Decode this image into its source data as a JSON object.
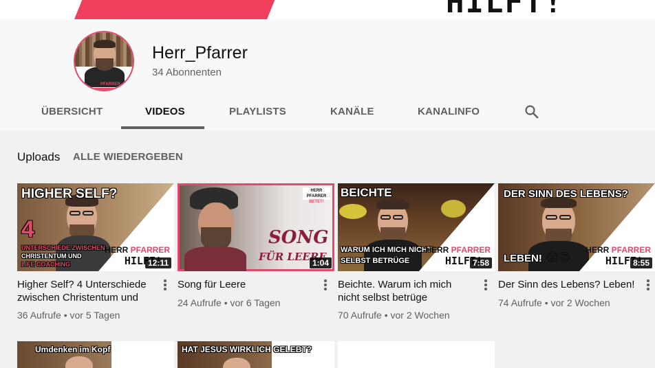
{
  "banner": {
    "text": "HILFT!"
  },
  "channel": {
    "name": "Herr_Pfarrer",
    "subscribers": "34 Abonnenten",
    "avatar_label_black": "HERR",
    "avatar_label_pink": "PFARRER"
  },
  "tabs": [
    {
      "label": "ÜBERSICHT"
    },
    {
      "label": "VIDEOS"
    },
    {
      "label": "PLAYLISTS"
    },
    {
      "label": "KANÄLE"
    },
    {
      "label": "KANALINFO"
    }
  ],
  "active_tab": "VIDEOS",
  "section": {
    "title": "Uploads",
    "play_all": "ALLE WIEDERGEBEN"
  },
  "videos": [
    {
      "title": "Higher Self? 4 Unterschiede zwischen Christentum und",
      "views": "36 Aufrufe",
      "age": "vor 5 Tagen",
      "duration": "12:11",
      "caption_top": "HIGHER SELF?",
      "caption_num": "4",
      "caption_lines": [
        "UNTERSCHIEDE ZWISCHEN",
        "CHRISTENTUM UND",
        "LIFE COACHING"
      ]
    },
    {
      "title": "Song für Leere",
      "views": "24 Aufrufe",
      "age": "vor 6 Tagen",
      "duration": "1:04",
      "caption_song": "SONG",
      "caption_fuer": "FÜR LEERE",
      "badge_black": "HERR PFARRER",
      "badge_pink": "BETET!"
    },
    {
      "title": "Beichte. Warum ich mich nicht selbst betrüge",
      "views": "70 Aufrufe",
      "age": "vor 2 Wochen",
      "duration": "7:58",
      "caption_top": "BEICHTE",
      "caption_lines": [
        "WARUM ICH MICH NICHT",
        "SELBST BETRÜGE"
      ]
    },
    {
      "title": "Der Sinn des Lebens? Leben!",
      "views": "74 Aufrufe",
      "age": "vor 2 Wochen",
      "duration": "8:55",
      "caption_top": "DER SINN DES LEBENS?",
      "caption_bottom": "LEBEN!",
      "emojis": "😱😍"
    }
  ],
  "brand": {
    "herr": "HERR",
    "pfarrer": "PFARRER",
    "hilft": "HILFT!"
  },
  "row2": [
    {
      "caption": "Umdenken im Kopf"
    },
    {
      "caption": "HAT JESUS WIRKLICH GELEBT?"
    },
    {
      "caption": ""
    }
  ],
  "colors": {
    "accent_pink": "#e14a6a",
    "banner_red": "#ef3f5c",
    "meta_gray": "#606060"
  },
  "icons": {
    "search": "search-icon",
    "more": "more-vertical-icon"
  }
}
